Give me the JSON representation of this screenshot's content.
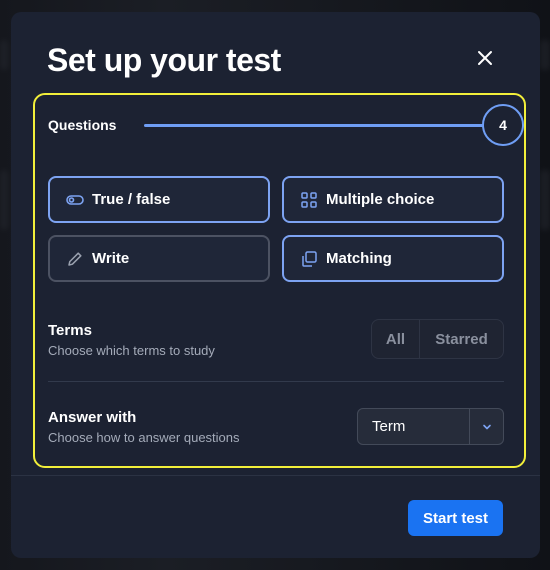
{
  "modal": {
    "title": "Set up your test",
    "close_icon": "close-icon"
  },
  "questions": {
    "label": "Questions",
    "count": "4",
    "slider_fraction": 1.0
  },
  "question_types": [
    {
      "label": "True / false",
      "icon": "toggle-icon",
      "selected": true
    },
    {
      "label": "Multiple choice",
      "icon": "grid-icon",
      "selected": true
    },
    {
      "label": "Write",
      "icon": "pencil-icon",
      "selected": false
    },
    {
      "label": "Matching",
      "icon": "copy-icon",
      "selected": true
    }
  ],
  "terms": {
    "title": "Terms",
    "subtitle": "Choose which terms to study",
    "options": [
      "All",
      "Starred"
    ]
  },
  "answer_with": {
    "title": "Answer with",
    "subtitle": "Choose how to answer questions",
    "selected": "Term",
    "chevron_icon": "chevron-down-icon"
  },
  "footer": {
    "start_label": "Start test"
  },
  "colors": {
    "modal_bg": "#1c2232",
    "accent": "#6f9ef5",
    "highlight_border": "#f2ef3a",
    "primary_button": "#1a73f2"
  }
}
